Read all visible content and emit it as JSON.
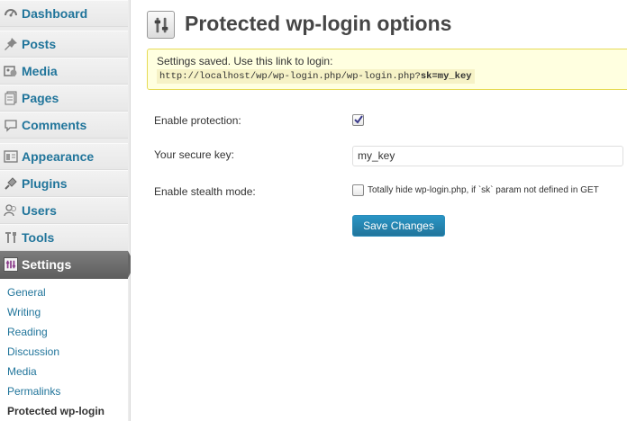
{
  "sidebar": {
    "items": [
      {
        "label": "Dashboard",
        "icon": "dashboard-icon"
      },
      {
        "label": "Posts",
        "icon": "pushpin-icon"
      },
      {
        "label": "Media",
        "icon": "media-icon"
      },
      {
        "label": "Pages",
        "icon": "pages-icon"
      },
      {
        "label": "Comments",
        "icon": "comment-icon"
      },
      {
        "label": "Appearance",
        "icon": "appearance-icon"
      },
      {
        "label": "Plugins",
        "icon": "plug-icon"
      },
      {
        "label": "Users",
        "icon": "users-icon"
      },
      {
        "label": "Tools",
        "icon": "tools-icon"
      }
    ],
    "active": {
      "label": "Settings",
      "icon": "settings-icon"
    },
    "submenu": [
      "General",
      "Writing",
      "Reading",
      "Discussion",
      "Media",
      "Permalinks",
      "Protected wp-login"
    ],
    "current_submenu": "Protected wp-login"
  },
  "page": {
    "title": "Protected wp-login options",
    "icon": "settings-sliders-icon"
  },
  "notice": {
    "message": "Settings saved. Use this link to login:",
    "link_prefix": "http://localhost/wp/wp-login.php/wp-login.php?",
    "link_key": "sk=my_key"
  },
  "form": {
    "enable_protection_label": "Enable protection:",
    "enable_protection_checked": true,
    "secure_key_label": "Your secure key:",
    "secure_key_value": "my_key",
    "stealth_label": "Enable stealth mode:",
    "stealth_checked": false,
    "stealth_description": "Totally hide wp-login.php, if `sk` param not defined in GET",
    "save_label": "Save Changes"
  },
  "colors": {
    "link": "#21759b",
    "notice_bg": "#ffffe0",
    "notice_border": "#e6db55",
    "button": "#21759b"
  }
}
